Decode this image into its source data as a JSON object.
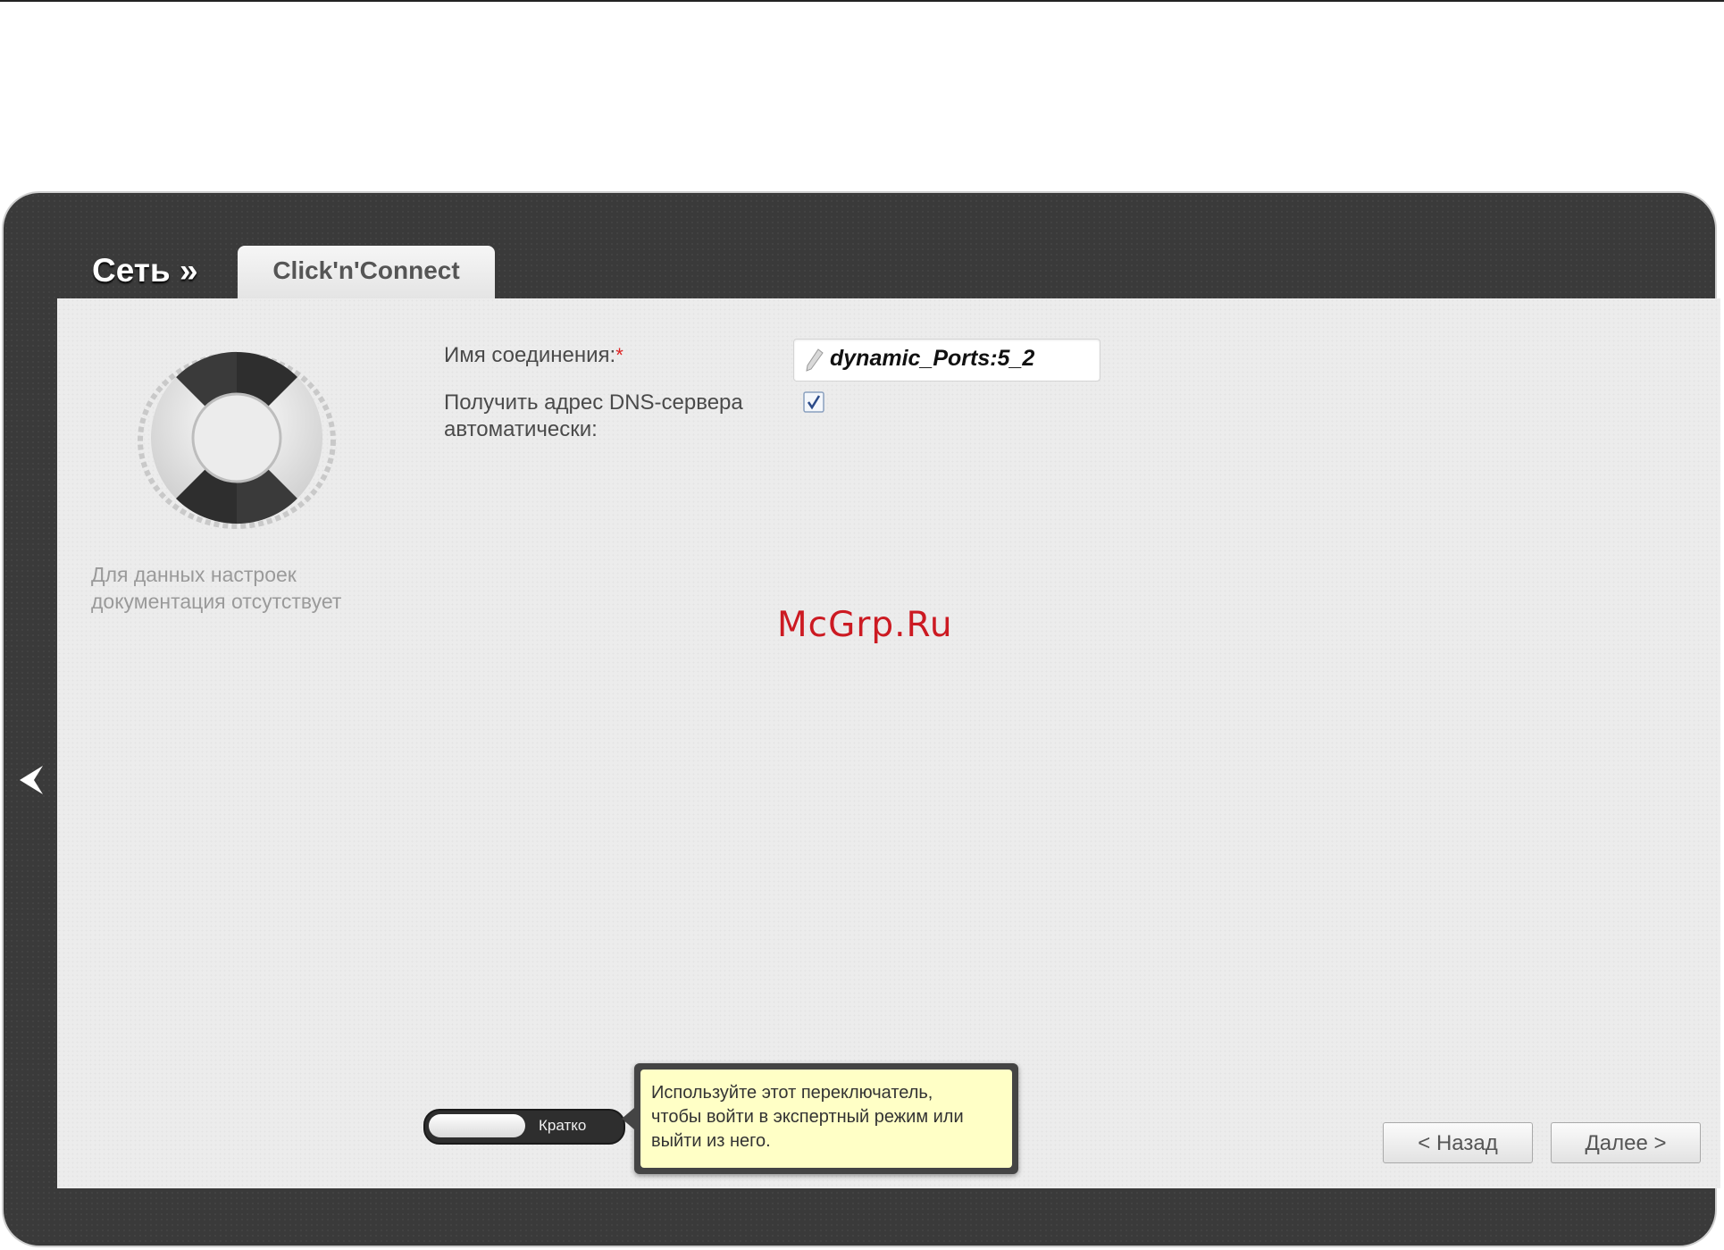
{
  "header": {
    "section_title": "Сеть »",
    "active_tab": "Click'n'Connect"
  },
  "sidebar": {
    "help_text": "Для данных настроек документация отсутствует"
  },
  "form": {
    "connection_name_label": "Имя соединения:",
    "required_marker": "*",
    "connection_name_value": "dynamic_Ports:5_2",
    "dns_auto_label_line1": "Получить адрес DNS-сервера",
    "dns_auto_label_line2": "автоматически:",
    "dns_auto_checked": true
  },
  "mode_switch": {
    "label": "Кратко",
    "tooltip_line1": "Используйте этот переключатель,",
    "tooltip_line2": "чтобы войти в экспертный режим или",
    "tooltip_line3": "выйти из него."
  },
  "navigation": {
    "back_label": "< Назад",
    "next_label": "Далее >"
  },
  "watermark": "McGrp.Ru",
  "icons": {
    "help": "lifebuoy-icon",
    "edit": "pencil-icon",
    "checkbox": "checkmark-icon",
    "collapse": "chevron-left-icon"
  }
}
